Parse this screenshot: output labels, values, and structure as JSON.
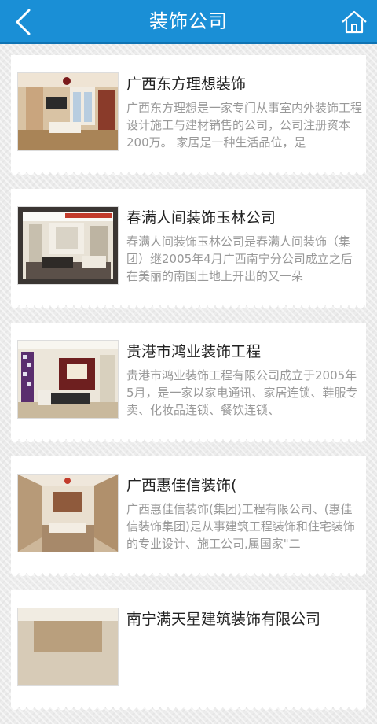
{
  "header": {
    "title": "装饰公司",
    "back_icon": "back-arrow-icon",
    "home_icon": "home-icon"
  },
  "colors": {
    "header_bg": "#1a8fd6",
    "title_text": "#ffffff",
    "card_title": "#222222",
    "card_desc": "#999999"
  },
  "companies": [
    {
      "name": "广西东方理想装饰",
      "description": "广西东方理想是一家专门从事室内外装饰工程设计施工与建材销售的公司，公司注册资本200万。 家居是一种生活品位，是"
    },
    {
      "name": "春满人间装饰玉林公司",
      "description": "春满人间装饰玉林公司是春满人间装饰（集团）继2005年4月广西南宁分公司成立之后在美丽的南国土地上开出的又一朵"
    },
    {
      "name": "贵港市鸿业装饰工程",
      "description": "贵港市鸿业装饰工程有限公司成立于2005年5月，是一家以家电通讯、家居连锁、鞋服专卖、化妆品连锁、餐饮连锁、"
    },
    {
      "name": "广西惠佳信装饰(",
      "description": "广西惠佳信装饰(集团)工程有限公司、(惠佳信装饰集团)是从事建筑工程装饰和住宅装饰的专业设计、施工公司,属国家\"二"
    },
    {
      "name": "南宁满天星建筑装饰有限公司",
      "description": ""
    }
  ]
}
